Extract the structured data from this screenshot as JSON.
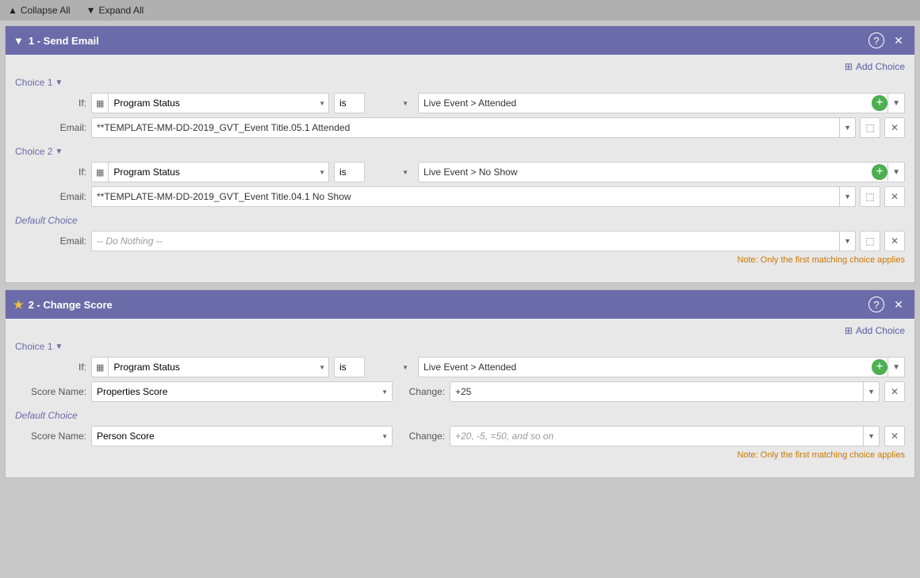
{
  "toolbar": {
    "collapse_all": "Collapse All",
    "expand_all": "Expand All"
  },
  "step1": {
    "title": "1 - Send Email",
    "add_choice_label": "Add Choice",
    "choice1": {
      "label": "Choice 1",
      "if_field": "Program Status",
      "operator": "is",
      "value": "Live Event > Attended",
      "email_label": "Email:",
      "email_value": "**TEMPLATE-MM-DD-2019_GVT_Event Title.05.1 Attended"
    },
    "choice2": {
      "label": "Choice 2",
      "if_field": "Program Status",
      "operator": "is",
      "value": "Live Event > No Show",
      "email_label": "Email:",
      "email_value": "**TEMPLATE-MM-DD-2019_GVT_Event Title.04.1 No Show"
    },
    "default_choice": {
      "label": "Default Choice",
      "email_label": "Email:",
      "email_value": "-- Do Nothing --"
    },
    "note": "Note: Only the first matching choice applies"
  },
  "step2": {
    "title": "2 - Change Score",
    "add_choice_label": "Add Choice",
    "choice1": {
      "label": "Choice 1",
      "if_field": "Program Status",
      "operator": "is",
      "value": "Live Event > Attended",
      "score_name_label": "Score Name:",
      "score_name_value": "Properties Score",
      "change_label": "Change:",
      "change_value": "+25"
    },
    "default_choice": {
      "label": "Default Choice",
      "score_name_label": "Score Name:",
      "score_name_value": "Person Score",
      "change_label": "Change:",
      "change_placeholder": "+20, -5, =50, and so on"
    },
    "note": "Note: Only the first matching choice applies"
  },
  "icons": {
    "collapse_arrow": "▲",
    "expand_arrow": "▼",
    "up_arrow": "▲",
    "close": "✕",
    "info": "?",
    "calendar": "▦",
    "add": "+",
    "preview": "⬚",
    "delete": "✕",
    "star": "★",
    "arrow_down": "▼"
  }
}
